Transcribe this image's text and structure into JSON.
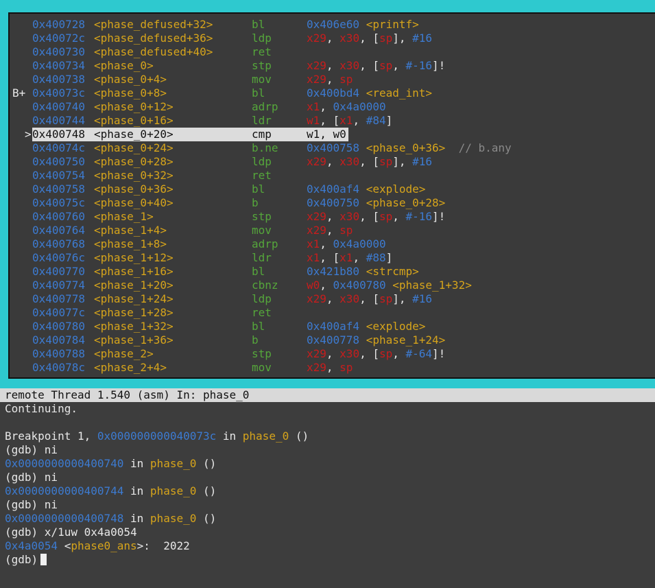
{
  "asm": {
    "lines": [
      {
        "marker": "",
        "addr": "0x400728",
        "sym": "<phase_defused+32>",
        "mnem": "bl",
        "ops": [
          {
            "t": "0x406e60",
            "c": "hex"
          },
          {
            "t": " ",
            "c": "w"
          },
          {
            "t": "<printf>",
            "c": "sym"
          }
        ]
      },
      {
        "marker": "",
        "addr": "0x40072c",
        "sym": "<phase_defused+36>",
        "mnem": "ldp",
        "ops": [
          {
            "t": "x29",
            "c": "reg"
          },
          {
            "t": ", ",
            "c": "w"
          },
          {
            "t": "x30",
            "c": "reg"
          },
          {
            "t": ", [",
            "c": "w"
          },
          {
            "t": "sp",
            "c": "reg"
          },
          {
            "t": "], ",
            "c": "w"
          },
          {
            "t": "#16",
            "c": "hex"
          }
        ]
      },
      {
        "marker": "",
        "addr": "0x400730",
        "sym": "<phase_defused+40>",
        "mnem": "ret",
        "ops": []
      },
      {
        "marker": "",
        "addr": "0x400734",
        "sym": "<phase_0>",
        "mnem": "stp",
        "ops": [
          {
            "t": "x29",
            "c": "reg"
          },
          {
            "t": ", ",
            "c": "w"
          },
          {
            "t": "x30",
            "c": "reg"
          },
          {
            "t": ", [",
            "c": "w"
          },
          {
            "t": "sp",
            "c": "reg"
          },
          {
            "t": ", ",
            "c": "w"
          },
          {
            "t": "#-16",
            "c": "hex"
          },
          {
            "t": "]!",
            "c": "w"
          }
        ]
      },
      {
        "marker": "",
        "addr": "0x400738",
        "sym": "<phase_0+4>",
        "mnem": "mov",
        "ops": [
          {
            "t": "x29",
            "c": "reg"
          },
          {
            "t": ", ",
            "c": "w"
          },
          {
            "t": "sp",
            "c": "reg"
          }
        ]
      },
      {
        "marker": "B+",
        "addr": "0x40073c",
        "sym": "<phase_0+8>",
        "mnem": "bl",
        "ops": [
          {
            "t": "0x400bd4",
            "c": "hex"
          },
          {
            "t": " ",
            "c": "w"
          },
          {
            "t": "<read_int>",
            "c": "sym"
          }
        ]
      },
      {
        "marker": "",
        "addr": "0x400740",
        "sym": "<phase_0+12>",
        "mnem": "adrp",
        "ops": [
          {
            "t": "x1",
            "c": "reg"
          },
          {
            "t": ", ",
            "c": "w"
          },
          {
            "t": "0x4a0000",
            "c": "hex"
          }
        ]
      },
      {
        "marker": "",
        "addr": "0x400744",
        "sym": "<phase_0+16>",
        "mnem": "ldr",
        "ops": [
          {
            "t": "w1",
            "c": "reg"
          },
          {
            "t": ", [",
            "c": "w"
          },
          {
            "t": "x1",
            "c": "reg"
          },
          {
            "t": ", ",
            "c": "w"
          },
          {
            "t": "#84",
            "c": "hex"
          },
          {
            "t": "]",
            "c": "w"
          }
        ]
      },
      {
        "marker": ">",
        "addr": "0x400748",
        "sym": "<phase_0+20>",
        "mnem": "cmp",
        "ops": [
          {
            "t": "w1, w0",
            "c": "w"
          }
        ],
        "current": true
      },
      {
        "marker": "",
        "addr": "0x40074c",
        "sym": "<phase_0+24>",
        "mnem": "b.ne",
        "ops": [
          {
            "t": "0x400758",
            "c": "hex"
          },
          {
            "t": " ",
            "c": "w"
          },
          {
            "t": "<phase_0+36>",
            "c": "sym"
          },
          {
            "t": "  // b.any",
            "c": "comment"
          }
        ]
      },
      {
        "marker": "",
        "addr": "0x400750",
        "sym": "<phase_0+28>",
        "mnem": "ldp",
        "ops": [
          {
            "t": "x29",
            "c": "reg"
          },
          {
            "t": ", ",
            "c": "w"
          },
          {
            "t": "x30",
            "c": "reg"
          },
          {
            "t": ", [",
            "c": "w"
          },
          {
            "t": "sp",
            "c": "reg"
          },
          {
            "t": "], ",
            "c": "w"
          },
          {
            "t": "#16",
            "c": "hex"
          }
        ]
      },
      {
        "marker": "",
        "addr": "0x400754",
        "sym": "<phase_0+32>",
        "mnem": "ret",
        "ops": []
      },
      {
        "marker": "",
        "addr": "0x400758",
        "sym": "<phase_0+36>",
        "mnem": "bl",
        "ops": [
          {
            "t": "0x400af4",
            "c": "hex"
          },
          {
            "t": " ",
            "c": "w"
          },
          {
            "t": "<explode>",
            "c": "sym"
          }
        ]
      },
      {
        "marker": "",
        "addr": "0x40075c",
        "sym": "<phase_0+40>",
        "mnem": "b",
        "ops": [
          {
            "t": "0x400750",
            "c": "hex"
          },
          {
            "t": " ",
            "c": "w"
          },
          {
            "t": "<phase_0+28>",
            "c": "sym"
          }
        ]
      },
      {
        "marker": "",
        "addr": "0x400760",
        "sym": "<phase_1>",
        "mnem": "stp",
        "ops": [
          {
            "t": "x29",
            "c": "reg"
          },
          {
            "t": ", ",
            "c": "w"
          },
          {
            "t": "x30",
            "c": "reg"
          },
          {
            "t": ", [",
            "c": "w"
          },
          {
            "t": "sp",
            "c": "reg"
          },
          {
            "t": ", ",
            "c": "w"
          },
          {
            "t": "#-16",
            "c": "hex"
          },
          {
            "t": "]!",
            "c": "w"
          }
        ]
      },
      {
        "marker": "",
        "addr": "0x400764",
        "sym": "<phase_1+4>",
        "mnem": "mov",
        "ops": [
          {
            "t": "x29",
            "c": "reg"
          },
          {
            "t": ", ",
            "c": "w"
          },
          {
            "t": "sp",
            "c": "reg"
          }
        ]
      },
      {
        "marker": "",
        "addr": "0x400768",
        "sym": "<phase_1+8>",
        "mnem": "adrp",
        "ops": [
          {
            "t": "x1",
            "c": "reg"
          },
          {
            "t": ", ",
            "c": "w"
          },
          {
            "t": "0x4a0000",
            "c": "hex"
          }
        ]
      },
      {
        "marker": "",
        "addr": "0x40076c",
        "sym": "<phase_1+12>",
        "mnem": "ldr",
        "ops": [
          {
            "t": "x1",
            "c": "reg"
          },
          {
            "t": ", [",
            "c": "w"
          },
          {
            "t": "x1",
            "c": "reg"
          },
          {
            "t": ", ",
            "c": "w"
          },
          {
            "t": "#88",
            "c": "hex"
          },
          {
            "t": "]",
            "c": "w"
          }
        ]
      },
      {
        "marker": "",
        "addr": "0x400770",
        "sym": "<phase_1+16>",
        "mnem": "bl",
        "ops": [
          {
            "t": "0x421b80",
            "c": "hex"
          },
          {
            "t": " ",
            "c": "w"
          },
          {
            "t": "<strcmp>",
            "c": "sym"
          }
        ]
      },
      {
        "marker": "",
        "addr": "0x400774",
        "sym": "<phase_1+20>",
        "mnem": "cbnz",
        "ops": [
          {
            "t": "w0",
            "c": "reg"
          },
          {
            "t": ", ",
            "c": "w"
          },
          {
            "t": "0x400780",
            "c": "hex"
          },
          {
            "t": " ",
            "c": "w"
          },
          {
            "t": "<phase_1+32>",
            "c": "sym"
          }
        ]
      },
      {
        "marker": "",
        "addr": "0x400778",
        "sym": "<phase_1+24>",
        "mnem": "ldp",
        "ops": [
          {
            "t": "x29",
            "c": "reg"
          },
          {
            "t": ", ",
            "c": "w"
          },
          {
            "t": "x30",
            "c": "reg"
          },
          {
            "t": ", [",
            "c": "w"
          },
          {
            "t": "sp",
            "c": "reg"
          },
          {
            "t": "], ",
            "c": "w"
          },
          {
            "t": "#16",
            "c": "hex"
          }
        ]
      },
      {
        "marker": "",
        "addr": "0x40077c",
        "sym": "<phase_1+28>",
        "mnem": "ret",
        "ops": []
      },
      {
        "marker": "",
        "addr": "0x400780",
        "sym": "<phase_1+32>",
        "mnem": "bl",
        "ops": [
          {
            "t": "0x400af4",
            "c": "hex"
          },
          {
            "t": " ",
            "c": "w"
          },
          {
            "t": "<explode>",
            "c": "sym"
          }
        ]
      },
      {
        "marker": "",
        "addr": "0x400784",
        "sym": "<phase_1+36>",
        "mnem": "b",
        "ops": [
          {
            "t": "0x400778",
            "c": "hex"
          },
          {
            "t": " ",
            "c": "w"
          },
          {
            "t": "<phase_1+24>",
            "c": "sym"
          }
        ]
      },
      {
        "marker": "",
        "addr": "0x400788",
        "sym": "<phase_2>",
        "mnem": "stp",
        "ops": [
          {
            "t": "x29",
            "c": "reg"
          },
          {
            "t": ", ",
            "c": "w"
          },
          {
            "t": "x30",
            "c": "reg"
          },
          {
            "t": ", [",
            "c": "w"
          },
          {
            "t": "sp",
            "c": "reg"
          },
          {
            "t": ", ",
            "c": "w"
          },
          {
            "t": "#-64",
            "c": "hex"
          },
          {
            "t": "]!",
            "c": "w"
          }
        ]
      },
      {
        "marker": "",
        "addr": "0x40078c",
        "sym": "<phase_2+4>",
        "mnem": "mov",
        "ops": [
          {
            "t": "x29",
            "c": "reg"
          },
          {
            "t": ", ",
            "c": "w"
          },
          {
            "t": "sp",
            "c": "reg"
          }
        ]
      }
    ]
  },
  "status_bar": "remote Thread 1.540 (asm) In: phase_0",
  "console": {
    "lines": [
      [
        {
          "t": "Continuing.",
          "c": "w"
        }
      ],
      [],
      [
        {
          "t": "Breakpoint 1, ",
          "c": "w"
        },
        {
          "t": "0x000000000040073c",
          "c": "hex"
        },
        {
          "t": " in ",
          "c": "w"
        },
        {
          "t": "phase_0",
          "c": "sym"
        },
        {
          "t": " ()",
          "c": "w"
        }
      ],
      [
        {
          "t": "(gdb) ni",
          "c": "w"
        }
      ],
      [
        {
          "t": "0x0000000000400740",
          "c": "hex"
        },
        {
          "t": " in ",
          "c": "w"
        },
        {
          "t": "phase_0",
          "c": "sym"
        },
        {
          "t": " ()",
          "c": "w"
        }
      ],
      [
        {
          "t": "(gdb) ni",
          "c": "w"
        }
      ],
      [
        {
          "t": "0x0000000000400744",
          "c": "hex"
        },
        {
          "t": " in ",
          "c": "w"
        },
        {
          "t": "phase_0",
          "c": "sym"
        },
        {
          "t": " ()",
          "c": "w"
        }
      ],
      [
        {
          "t": "(gdb) ni",
          "c": "w"
        }
      ],
      [
        {
          "t": "0x0000000000400748",
          "c": "hex"
        },
        {
          "t": " in ",
          "c": "w"
        },
        {
          "t": "phase_0",
          "c": "sym"
        },
        {
          "t": " ()",
          "c": "w"
        }
      ],
      [
        {
          "t": "(gdb) x/1uw 0x4a0054",
          "c": "w"
        }
      ],
      [
        {
          "t": "0x4a0054",
          "c": "hex"
        },
        {
          "t": " <",
          "c": "w"
        },
        {
          "t": "phase0_ans",
          "c": "sym"
        },
        {
          "t": ">:  2022",
          "c": "w"
        }
      ]
    ],
    "prompt": "(gdb)"
  }
}
